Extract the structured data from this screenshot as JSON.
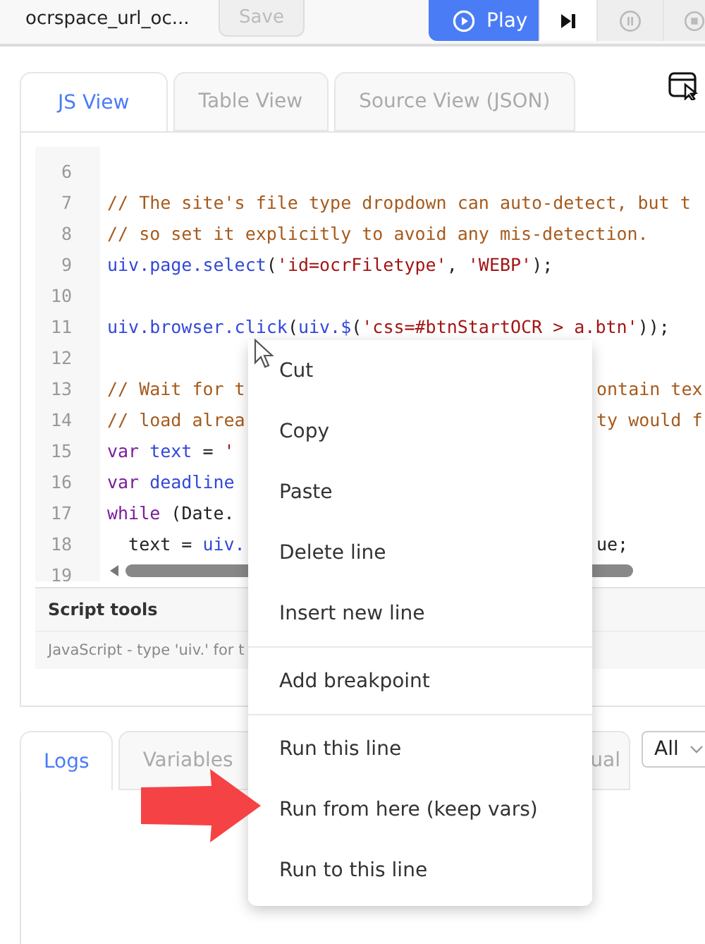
{
  "toolbar": {
    "script_name": "ocrspace_url_oc...",
    "save": {
      "label": "Save",
      "disabled": true
    },
    "play": {
      "label": "Play"
    }
  },
  "editor_tabs": [
    {
      "label": "JS View",
      "selected": true
    },
    {
      "label": "Table View",
      "selected": false
    },
    {
      "label": "Source View (JSON)",
      "selected": false
    }
  ],
  "code_lines": [
    {
      "number": "6"
    },
    {
      "number": "7",
      "tokens": [
        {
          "text": "// The site's file type dropdown can auto-detect, but t",
          "kind": "comment"
        }
      ]
    },
    {
      "number": "8",
      "tokens": [
        {
          "text": "// so set it explicitly to avoid any mis-detection.",
          "kind": "comment"
        }
      ]
    },
    {
      "number": "9",
      "tokens": [
        {
          "text": "uiv.page.select",
          "kind": "name"
        },
        {
          "text": "(",
          "kind": "plain"
        },
        {
          "text": "'id=ocrFiletype'",
          "kind": "string"
        },
        {
          "text": ", ",
          "kind": "plain"
        },
        {
          "text": "'WEBP'",
          "kind": "string"
        },
        {
          "text": ");",
          "kind": "plain"
        }
      ]
    },
    {
      "number": "10"
    },
    {
      "number": "11",
      "tokens": [
        {
          "text": "uiv.browser.click",
          "kind": "name"
        },
        {
          "text": "(",
          "kind": "plain"
        },
        {
          "text": "uiv.$",
          "kind": "name"
        },
        {
          "text": "(",
          "kind": "plain"
        },
        {
          "text": "'css=#btnStartOCR > a.btn'",
          "kind": "string"
        },
        {
          "text": "));",
          "kind": "plain"
        }
      ]
    },
    {
      "number": "12"
    },
    {
      "number": "13",
      "tokens": [
        {
          "text": "// Wait for t",
          "kind": "comment"
        }
      ],
      "tokens_after": [
        {
          "text": "ontain tex",
          "kind": "comment"
        }
      ]
    },
    {
      "number": "14",
      "tokens": [
        {
          "text": "// load alrea",
          "kind": "comment"
        }
      ],
      "tokens_after": [
        {
          "text": "ty would f",
          "kind": "comment"
        }
      ]
    },
    {
      "number": "15",
      "tokens": [
        {
          "text": "var",
          "kind": "keyword"
        },
        {
          "text": " text",
          "kind": "name"
        },
        {
          "text": " = ",
          "kind": "plain"
        },
        {
          "text": "'",
          "kind": "string"
        }
      ]
    },
    {
      "number": "16",
      "tokens": [
        {
          "text": "var",
          "kind": "keyword"
        },
        {
          "text": " deadline",
          "kind": "name"
        }
      ]
    },
    {
      "number": "17",
      "tokens": [
        {
          "text": "while",
          "kind": "keyword"
        },
        {
          "text": " (Date.",
          "kind": "plain"
        }
      ]
    },
    {
      "number": "18",
      "tokens": [
        {
          "text": "  text = ",
          "kind": "plain"
        },
        {
          "text": "uiv.",
          "kind": "name"
        }
      ],
      "tokens_after": [
        {
          "text": "ue;",
          "kind": "plain"
        }
      ]
    },
    {
      "number": "19"
    }
  ],
  "script_tools": {
    "title": "Script tools",
    "hint": "JavaScript - type 'uiv.' for t"
  },
  "bottom_tabs": [
    {
      "label": "Logs",
      "selected": true
    },
    {
      "label": "Variables",
      "selected": false
    },
    {
      "label": "ual",
      "selected": false
    }
  ],
  "log_filter": {
    "value": "All"
  },
  "context_menu": [
    {
      "label": "Cut",
      "kind": "item"
    },
    {
      "label": "Copy",
      "kind": "item"
    },
    {
      "label": "Paste",
      "kind": "item"
    },
    {
      "label": "Delete line",
      "kind": "item"
    },
    {
      "label": "Insert new line",
      "kind": "item"
    },
    {
      "kind": "divider"
    },
    {
      "label": "Add breakpoint",
      "kind": "item"
    },
    {
      "kind": "divider"
    },
    {
      "label": "Run this line",
      "kind": "item"
    },
    {
      "label": "Run from here (keep vars)",
      "kind": "item"
    },
    {
      "label": "Run to this line",
      "kind": "item"
    }
  ]
}
